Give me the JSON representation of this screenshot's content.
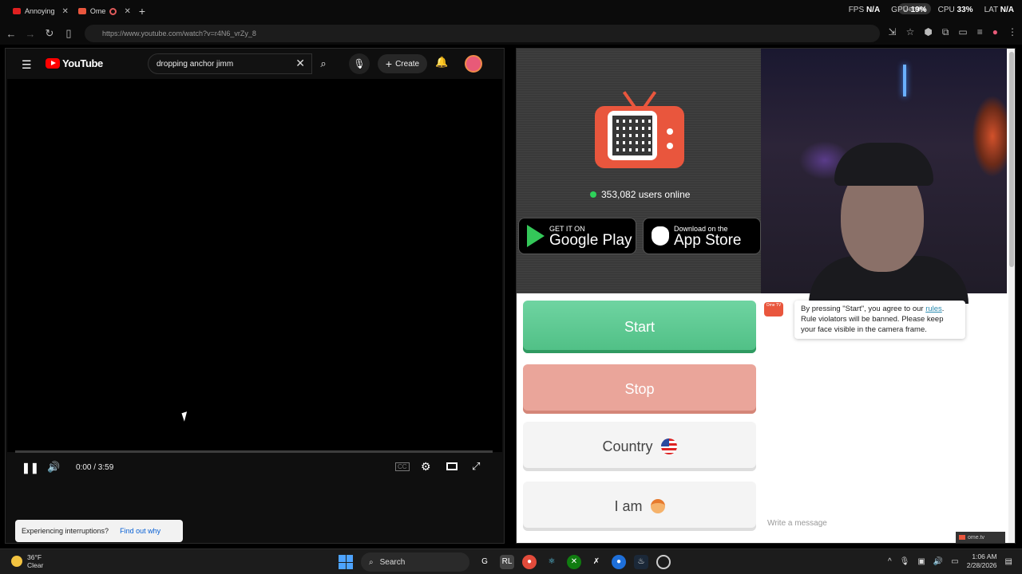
{
  "browser": {
    "tabs": [
      {
        "title": "Annoying",
        "favicon": "youtube-icon"
      },
      {
        "title": "Ome",
        "favicon": "ome-icon"
      }
    ],
    "url": "https://www.youtube.com/watch?v=r4N6_vrZy_8",
    "perf": {
      "fps_label": "FPS",
      "fps": "N/A",
      "gpu_label": "GPU",
      "gpu": "19%",
      "cpu_label": "CPU",
      "cpu": "33%",
      "lat_label": "LAT",
      "lat": "N/A"
    },
    "gemini_label": "Gemini"
  },
  "youtube": {
    "logo_text": "YouTube",
    "search_value": "dropping anchor jimm",
    "create_label": "Create",
    "time": "0:00 / 3:59",
    "progress": 0.0,
    "toast_text": "Experiencing interruptions?",
    "toast_link": "Find out why"
  },
  "ome": {
    "users_online": "353,082 users online",
    "google_small": "GET IT ON",
    "google_big": "Google Play",
    "apple_small": "Download on the",
    "apple_big": "App Store",
    "start_label": "Start",
    "stop_label": "Stop",
    "country_label": "Country",
    "iam_label": "I am",
    "rules_pre": "By pressing \"Start\", you agree to our ",
    "rules_link": "rules",
    "rules_post": ". Rule violators will be banned. Please keep your face visible in the camera frame.",
    "message_placeholder": "Write a message",
    "ome_tag": "ome.tv",
    "chat_logo": "Ome TV"
  },
  "taskbar": {
    "weather_temp": "36°F",
    "weather_desc": "Clear",
    "search_label": "Search",
    "time": "1:06 AM",
    "date": "2/28/2026"
  },
  "colors": {
    "ome_accent": "#e9563d",
    "start_green": "#5cc893",
    "stop_red": "#eaa59a",
    "youtube_red": "#ff0000"
  }
}
